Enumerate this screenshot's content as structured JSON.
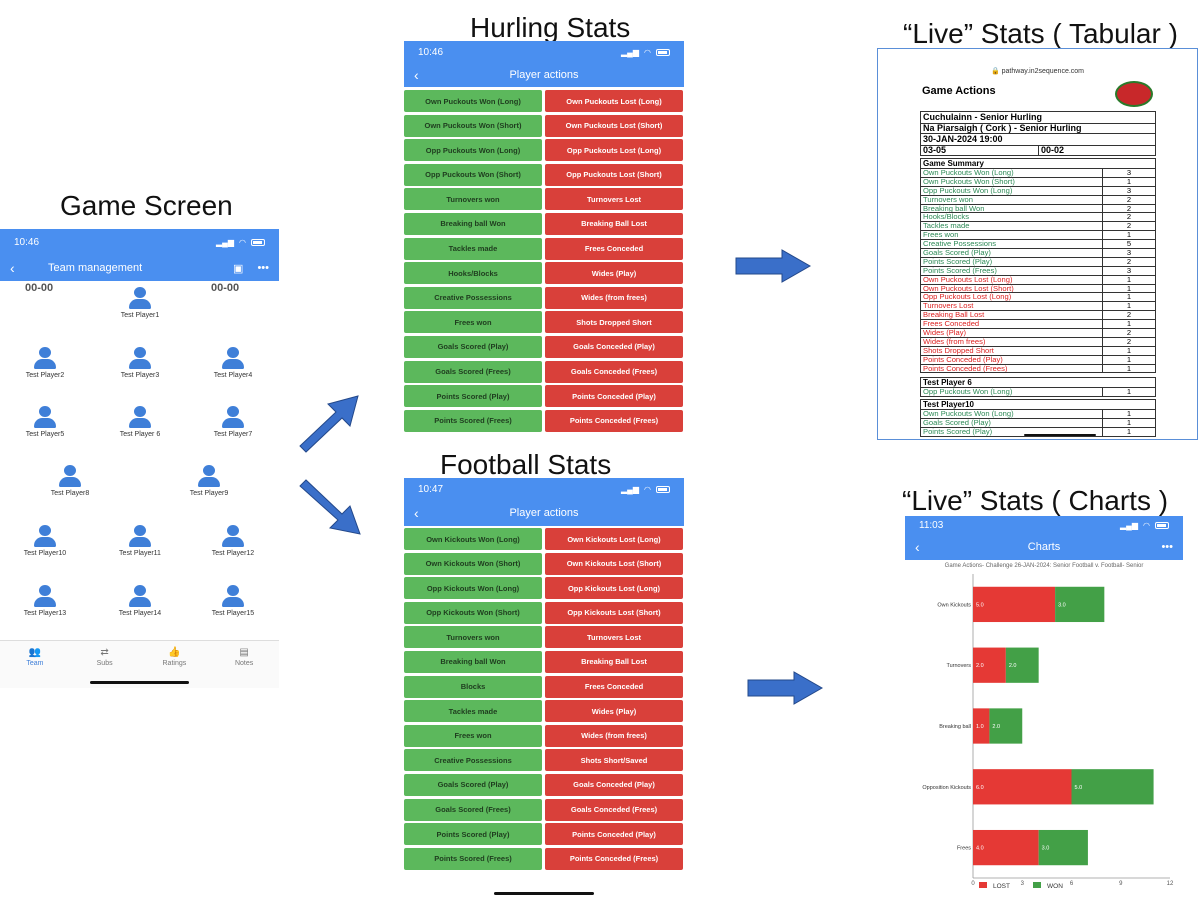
{
  "headings": {
    "game": "Game Screen",
    "hurling": "Hurling Stats",
    "football": "Football Stats",
    "tabular": "“Live” Stats ( Tabular )",
    "charts": "“Live” Stats ( Charts )"
  },
  "game_screen": {
    "time": "10:46",
    "title": "Team management",
    "score_left": "00-00",
    "score_right": "00-00",
    "players": [
      "Test Player1",
      "Test Player2",
      "Test Player3",
      "Test Player4",
      "Test Player5",
      "Test Player 6",
      "Test Player7",
      "Test Player8",
      "Test Player9",
      "Test Player10",
      "Test Player11",
      "Test Player12",
      "Test Player13",
      "Test Player14",
      "Test Player15"
    ],
    "nav": [
      {
        "label": "Team",
        "icon": "team-icon",
        "active": true
      },
      {
        "label": "Subs",
        "icon": "subs-icon",
        "active": false
      },
      {
        "label": "Ratings",
        "icon": "ratings-icon",
        "active": false
      },
      {
        "label": "Notes",
        "icon": "notes-icon",
        "active": false
      }
    ]
  },
  "hurling": {
    "time": "10:46",
    "title": "Player actions",
    "won": [
      "Own Puckouts Won (Long)",
      "Own Puckouts Won (Short)",
      "Opp Puckouts Won (Long)",
      "Opp Puckouts Won (Short)",
      "Turnovers won",
      "Breaking ball Won",
      "Tackles made",
      "Hooks/Blocks",
      "Creative Possessions",
      "Frees won",
      "Goals Scored (Play)",
      "Goals Scored (Frees)",
      "Points Scored (Play)",
      "Points Scored (Frees)"
    ],
    "lost": [
      "Own Puckouts Lost (Long)",
      "Own Puckouts Lost (Short)",
      "Opp Puckouts Lost (Long)",
      "Opp Puckouts Lost (Short)",
      "Turnovers Lost",
      "Breaking Ball Lost",
      "Frees Conceded",
      "Wides (Play)",
      "Wides (from frees)",
      "Shots Dropped Short",
      "Goals Conceded (Play)",
      "Goals Conceded (Frees)",
      "Points Conceded (Play)",
      "Points Conceded (Frees)"
    ]
  },
  "football": {
    "time": "10:47",
    "title": "Player actions",
    "won": [
      "Own Kickouts Won (Long)",
      "Own Kickouts Won (Short)",
      "Opp Kickouts Won (Long)",
      "Opp Kickouts Won (Short)",
      "Turnovers won",
      "Breaking ball Won",
      "Blocks",
      "Tackles made",
      "Frees won",
      "Creative Possessions",
      "Goals Scored (Play)",
      "Goals Scored (Frees)",
      "Points Scored (Play)",
      "Points Scored (Frees)"
    ],
    "lost": [
      "Own Kickouts Lost (Long)",
      "Own Kickouts Lost (Short)",
      "Opp Kickouts Lost (Long)",
      "Opp Kickouts Lost (Short)",
      "Turnovers Lost",
      "Breaking Ball Lost",
      "Frees Conceded",
      "Wides (Play)",
      "Wides (from frees)",
      "Shots Short/Saved",
      "Goals Conceded (Play)",
      "Goals Conceded (Frees)",
      "Points Conceded (Play)",
      "Points Conceded (Frees)"
    ]
  },
  "tabular": {
    "url": "pathway.in2sequence.com",
    "title": "Game Actions",
    "team_home": "Cuchulainn - Senior Hurling",
    "team_away": "Na Piarsaigh ( Cork ) - Senior Hurling",
    "datetime": "30-JAN-2024 19:00",
    "score_home": "03-05",
    "score_away": "00-02",
    "summary_label": "Game Summary",
    "summary": [
      {
        "k": "Own Puckouts Won (Long)",
        "v": "3",
        "c": "green"
      },
      {
        "k": "Own Puckouts Won (Short)",
        "v": "1",
        "c": "green"
      },
      {
        "k": "Opp Puckouts Won (Long)",
        "v": "3",
        "c": "green"
      },
      {
        "k": "Turnovers won",
        "v": "2",
        "c": "green"
      },
      {
        "k": "Breaking ball Won",
        "v": "2",
        "c": "green"
      },
      {
        "k": "Hooks/Blocks",
        "v": "2",
        "c": "green"
      },
      {
        "k": "Tackles made",
        "v": "2",
        "c": "green"
      },
      {
        "k": "Frees won",
        "v": "1",
        "c": "green"
      },
      {
        "k": "Creative Possessions",
        "v": "5",
        "c": "green"
      },
      {
        "k": "Goals Scored (Play)",
        "v": "3",
        "c": "green"
      },
      {
        "k": "Points Scored (Play)",
        "v": "2",
        "c": "green"
      },
      {
        "k": "Points Scored (Frees)",
        "v": "3",
        "c": "green"
      },
      {
        "k": "Own Puckouts Lost (Long)",
        "v": "1",
        "c": "red"
      },
      {
        "k": "Own Puckouts Lost (Short)",
        "v": "1",
        "c": "red"
      },
      {
        "k": "Opp Puckouts Lost (Long)",
        "v": "1",
        "c": "red"
      },
      {
        "k": "Turnovers Lost",
        "v": "1",
        "c": "red"
      },
      {
        "k": "Breaking Ball Lost",
        "v": "2",
        "c": "red"
      },
      {
        "k": "Frees Conceded",
        "v": "1",
        "c": "red"
      },
      {
        "k": "Wides (Play)",
        "v": "2",
        "c": "red"
      },
      {
        "k": "Wides (from frees)",
        "v": "2",
        "c": "red"
      },
      {
        "k": "Shots Dropped Short",
        "v": "1",
        "c": "red"
      },
      {
        "k": "Points Conceded (Play)",
        "v": "1",
        "c": "red"
      },
      {
        "k": "Points Conceded (Frees)",
        "v": "1",
        "c": "red"
      }
    ],
    "player6_label": "Test Player 6",
    "player6": [
      {
        "k": "Opp Puckouts Won (Long)",
        "v": "1",
        "c": "green"
      }
    ],
    "player10_label": "Test Player10",
    "player10": [
      {
        "k": "Own Puckouts Won (Long)",
        "v": "1",
        "c": "green"
      },
      {
        "k": "Goals Scored (Play)",
        "v": "1",
        "c": "green"
      },
      {
        "k": "Points Scored (Play)",
        "v": "1",
        "c": "green"
      }
    ]
  },
  "charts_screen": {
    "time": "11:03",
    "title": "Charts"
  },
  "chart_data": {
    "type": "bar",
    "orientation": "horizontal",
    "stacked": true,
    "title": "Game Actions- Challenge 26-JAN-2024: Senior Football v. Football- Senior",
    "categories": [
      "Own Kickouts",
      "Turnovers",
      "Breaking ball",
      "Opposition Kickouts",
      "Frees"
    ],
    "series": [
      {
        "name": "LOST",
        "color": "#e53935",
        "values": [
          5.0,
          2.0,
          1.0,
          6.0,
          4.0
        ]
      },
      {
        "name": "WON",
        "color": "#43a047",
        "values": [
          3.0,
          2.0,
          2.0,
          5.0,
          3.0
        ]
      }
    ],
    "xlim": [
      0,
      12
    ],
    "xticks": [
      "0",
      "3",
      "6",
      "9",
      "12"
    ],
    "legend_position": "bottom"
  },
  "colors": {
    "accent": "#4a8ff0",
    "won": "#5cb85c",
    "lost": "#d9403a",
    "arrow": "#3a6fc9"
  }
}
